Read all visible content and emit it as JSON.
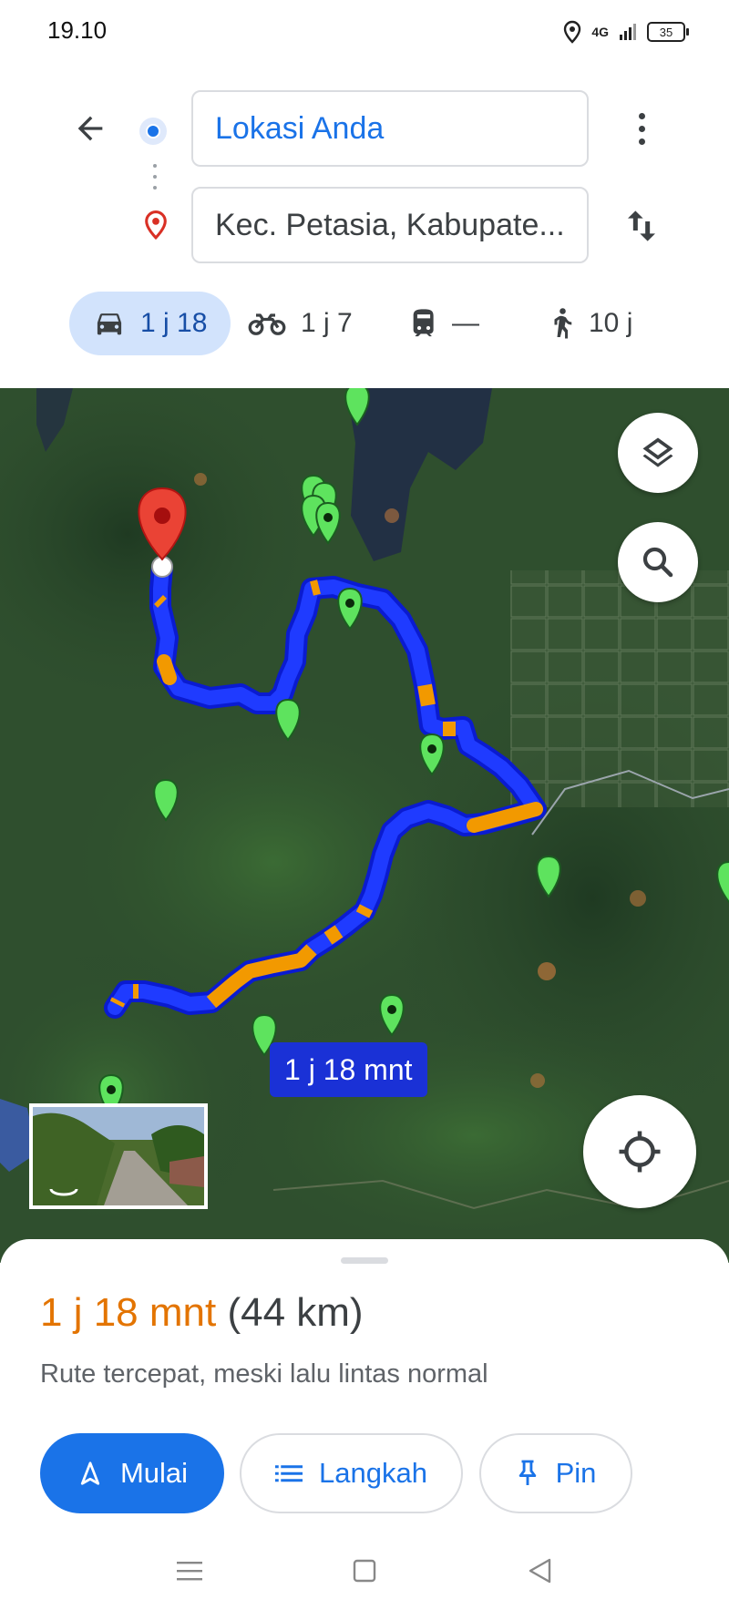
{
  "status_bar": {
    "time": "19.10",
    "network": "4G",
    "battery": "35"
  },
  "search": {
    "origin": "Lokasi Anda",
    "destination": "Kec. Petasia, Kabupate..."
  },
  "travel_modes": [
    {
      "mode": "car",
      "label": "1 j 18",
      "selected": true
    },
    {
      "mode": "motorcycle",
      "label": "1 j 7"
    },
    {
      "mode": "transit",
      "label": "—"
    },
    {
      "mode": "walk",
      "label": "10 j"
    }
  ],
  "map": {
    "route_duration_label": "1 j 18 mnt"
  },
  "summary": {
    "duration": "1 j 18 mnt",
    "distance": "(44 km)",
    "description": "Rute tercepat, meski lalu lintas normal"
  },
  "actions": {
    "start": "Mulai",
    "steps": "Langkah",
    "pin": "Pin"
  },
  "colors": {
    "accent": "#1a73e8",
    "route_blue": "#1f3bff",
    "route_traffic": "#f29900",
    "duration_orange": "#e37400",
    "mode_chip": "#d2e3fc"
  }
}
